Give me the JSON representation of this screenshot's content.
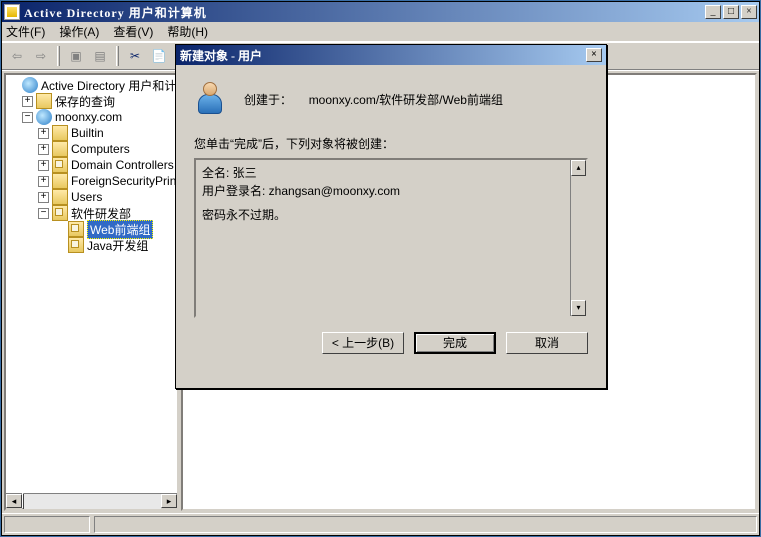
{
  "window": {
    "title": "Active Directory 用户和计算机",
    "controls": {
      "min": "_",
      "max": "□",
      "close": "×"
    }
  },
  "menubar": {
    "file": "文件(F)",
    "action": "操作(A)",
    "view": "查看(V)",
    "help": "帮助(H)"
  },
  "tree": {
    "root": "Active Directory 用户和计算机",
    "saved_queries": "保存的查询",
    "domain": "moonxy.com",
    "builtin": "Builtin",
    "computers": "Computers",
    "domain_controllers": "Domain Controllers",
    "foreign_sec": "ForeignSecurityPrincipals",
    "users": "Users",
    "dev_dept": "软件研发部",
    "web_group": "Web前端组",
    "java_group": "Java开发组"
  },
  "dialog": {
    "title": "新建对象 - 用户",
    "created_in_label": "创建于：",
    "created_in_path": "moonxy.com/软件研发部/Web前端组",
    "confirm_text": "您单击“完成”后，下列对象将被创建：",
    "full_name_label": "全名: ",
    "full_name_value": "张三",
    "logon_label": "用户登录名: ",
    "logon_value": "zhangsan@moonxy.com",
    "pwd_never_expires": "密码永不过期。",
    "btn_back": "< 上一步(B)",
    "btn_finish": "完成",
    "btn_cancel": "取消"
  }
}
